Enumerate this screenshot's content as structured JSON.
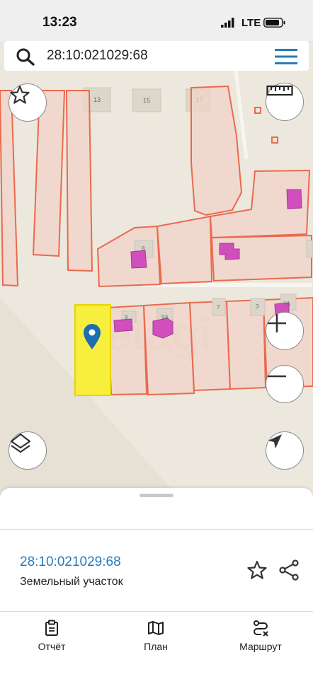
{
  "status_bar": {
    "time": "13:23",
    "network": "LTE"
  },
  "search": {
    "query": "28:10:021029:68"
  },
  "map": {
    "house_numbers": [
      "13",
      "15",
      "17",
      "8",
      "9",
      "9А",
      "7",
      "3",
      "1А"
    ],
    "watermark": "etagi"
  },
  "card": {
    "cadastral_number": "28:10:021029:68",
    "type": "Земельный участок"
  },
  "bottom_nav": [
    {
      "label": "Отчёт",
      "icon": "report-icon"
    },
    {
      "label": "План",
      "icon": "map-plan-icon"
    },
    {
      "label": "Маршрут",
      "icon": "route-icon"
    }
  ],
  "colors": {
    "parcel_stroke": "#ea6a4e",
    "parcel_fill": "#f2d3c8",
    "selected_parcel": "#f7ee3e",
    "building": "#d04fbd",
    "pin": "#1c6fae",
    "link": "#2a7ab8"
  }
}
